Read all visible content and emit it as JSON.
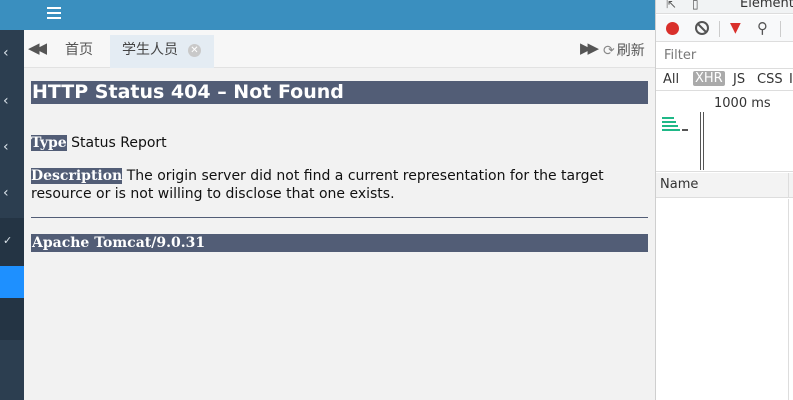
{
  "tabs": {
    "home_label": "首页",
    "active_label": "学生人员",
    "refresh_label": "刷新"
  },
  "error_page": {
    "title": "HTTP Status 404 – Not Found",
    "type_label": "Type",
    "type_value": " Status Report",
    "description_label": "Description",
    "description_value": " The origin server did not find a current representation for the target resource or is not willing to disclose that one exists.",
    "footer": "Apache Tomcat/9.0.31"
  },
  "devtools": {
    "top_tab": "Element",
    "filter_placeholder": "Filter",
    "types": [
      "All",
      "XHR",
      "JS",
      "CSS",
      "I"
    ],
    "selected_type": "XHR",
    "overview_tick": "1000 ms",
    "name_column": "Name",
    "record_color": "#d9302b",
    "bar_color": "#1fb887"
  },
  "colors": {
    "topbar": "#3a8fbf",
    "sidebar": "#2c3e50",
    "sidebar_active": "#1e90ff",
    "tomcat_header": "#525d76"
  }
}
